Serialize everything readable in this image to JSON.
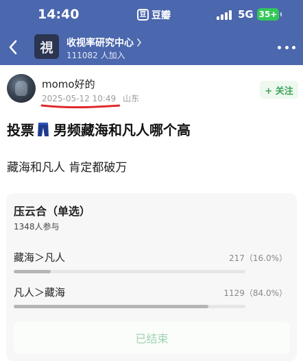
{
  "status_bar": {
    "time": "14:40",
    "app_logo_char": "豆",
    "app_name": "豆瓣",
    "network": "5G",
    "battery": "35+"
  },
  "nav": {
    "group_avatar_char": "視",
    "group_name": "收视率研究中心",
    "members": "111082 人加入"
  },
  "author": {
    "name": "momo好的",
    "date": "2025-05-12 10:49",
    "location": "山东",
    "follow_label": "+ 关注"
  },
  "post": {
    "title_prefix": "投票",
    "title_text": "男频藏海和凡人哪个高",
    "title_icon": "pants-icon",
    "body": "藏海和凡人 肯定都破万"
  },
  "poll": {
    "title": "压云合（单选）",
    "participants": "1348人参与",
    "options": [
      {
        "label": "藏海＞凡人",
        "stat": "217（16.0%）",
        "share": 0.16
      },
      {
        "label": "凡人＞藏海",
        "stat": "1129（84.0%）",
        "share": 0.84
      }
    ],
    "ended_label": "已结束"
  },
  "colors": {
    "header_bg": "#4b67ad",
    "follow_green": "#3ca35a",
    "battery_green": "#34c759",
    "underline_red": "#e0282a"
  }
}
